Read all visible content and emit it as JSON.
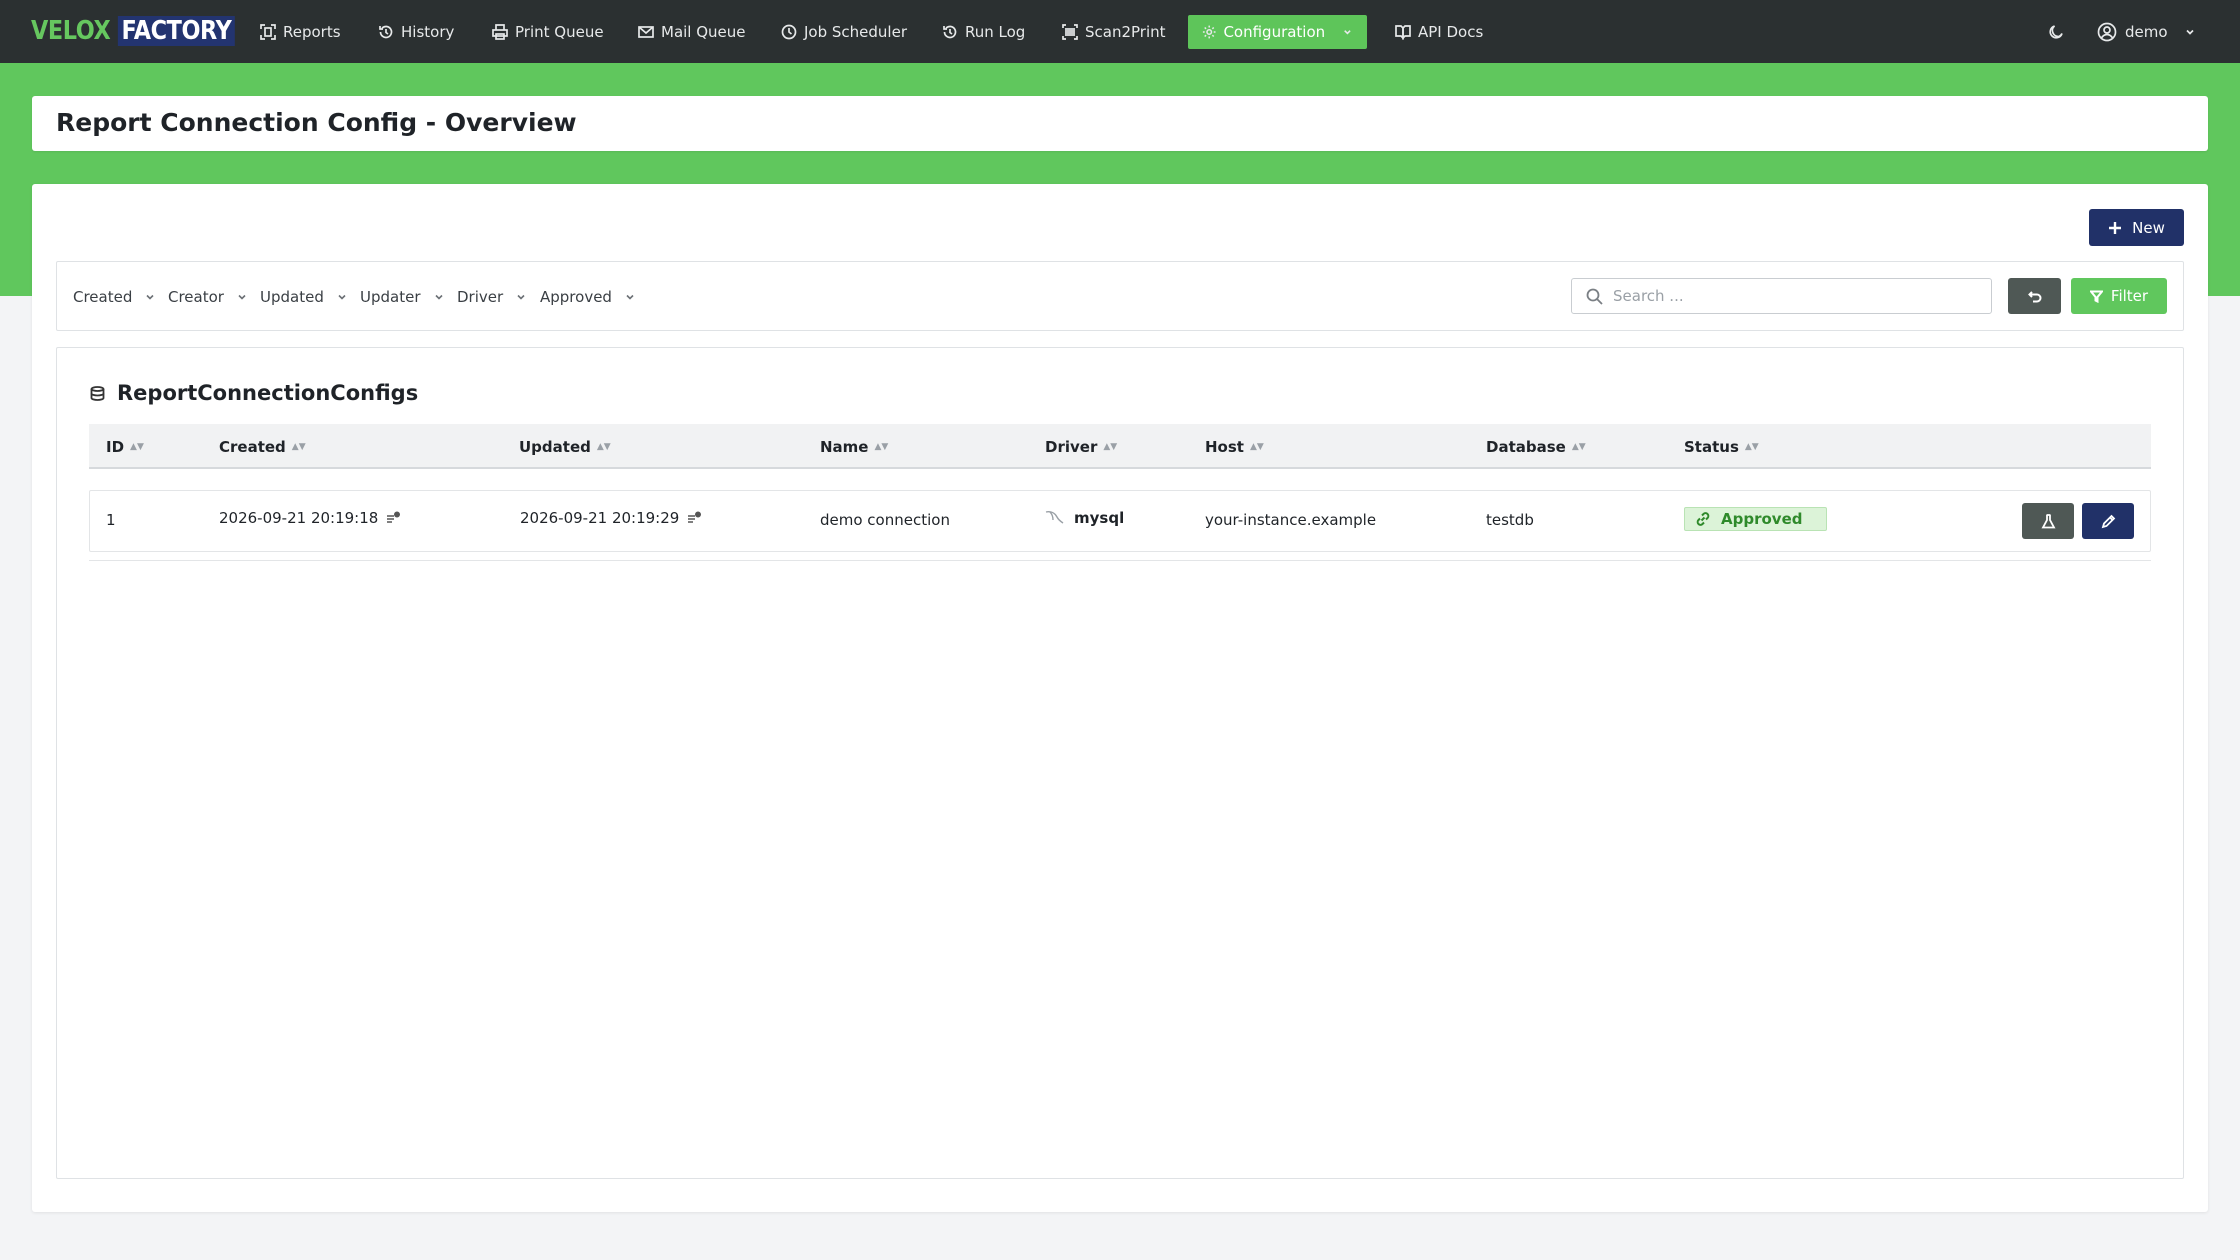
{
  "app": {
    "logo_part1": "VELOX",
    "logo_part2": "FACTORY"
  },
  "nav": {
    "items": [
      {
        "label": "Reports",
        "icon": "scan-frame-icon"
      },
      {
        "label": "History",
        "icon": "history-icon"
      },
      {
        "label": "Print Queue",
        "icon": "printer-icon"
      },
      {
        "label": "Mail Queue",
        "icon": "mail-icon"
      },
      {
        "label": "Job Scheduler",
        "icon": "clock-icon"
      },
      {
        "label": "Run Log",
        "icon": "history-icon"
      },
      {
        "label": "Scan2Print",
        "icon": "barcode-icon"
      },
      {
        "label": "Configuration",
        "icon": "gear-icon",
        "active": true
      },
      {
        "label": "API Docs",
        "icon": "book-icon"
      }
    ],
    "user": "demo"
  },
  "page": {
    "title": "Report Connection Config - Overview",
    "new_button": "New"
  },
  "filters": {
    "dropdowns": [
      "Created",
      "Creator",
      "Updated",
      "Updater",
      "Driver",
      "Approved"
    ],
    "search_placeholder": "Search ...",
    "search_value": "",
    "filter_button": "Filter"
  },
  "table": {
    "title": "ReportConnectionConfigs",
    "columns": [
      "ID",
      "Created",
      "Updated",
      "Name",
      "Driver",
      "Host",
      "Database",
      "Status"
    ],
    "rows": [
      {
        "id": "1",
        "created": "2026-09-21 20:19:18",
        "updated": "2026-09-21 20:19:29",
        "name": "demo connection",
        "driver": "mysql",
        "host": "your-instance.example",
        "database": "testdb",
        "status": "Approved"
      }
    ]
  },
  "colors": {
    "nav_bg": "#2b3031",
    "brand_green": "#60c75d",
    "brand_navy": "#213168",
    "status_green": "#2f8a2b"
  }
}
